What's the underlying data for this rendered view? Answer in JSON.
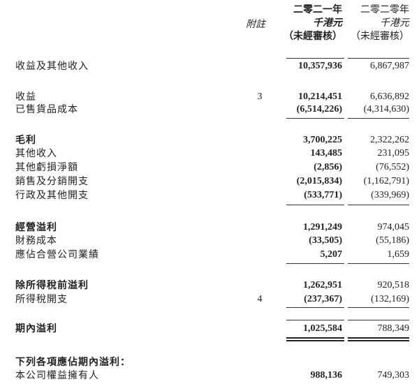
{
  "header": {
    "note_col": "附註",
    "cur_year": "二零二一年",
    "prev_year": "二零二零年",
    "cur_unit": "千港元",
    "prev_unit": "千港元",
    "cur_status": "（未經審核）",
    "prev_status": "（未經審核）"
  },
  "rows": [
    {
      "label": "收益及其他收入",
      "note": "",
      "cur": "10,357,936",
      "prev": "6,867,987",
      "bold": false
    },
    {
      "label": "收益",
      "note": "3",
      "cur": "10,214,451",
      "prev": "6,636,892",
      "bold": false
    },
    {
      "label": "已售貨品成本",
      "note": "",
      "cur": "(6,514,226)",
      "prev": "(4,314,630)",
      "bold": false
    },
    {
      "label": "毛利",
      "note": "",
      "cur": "3,700,225",
      "prev": "2,322,262",
      "bold": true
    },
    {
      "label": "其他收入",
      "note": "",
      "cur": "143,485",
      "prev": "231,095",
      "bold": false
    },
    {
      "label": "其他虧損淨額",
      "note": "",
      "cur": "(2,856)",
      "prev": "(76,552)",
      "bold": false
    },
    {
      "label": "銷售及分銷開支",
      "note": "",
      "cur": "(2,015,834)",
      "prev": "(1,162,791)",
      "bold": false
    },
    {
      "label": "行政及其他開支",
      "note": "",
      "cur": "(533,771)",
      "prev": "(339,969)",
      "bold": false
    },
    {
      "label": "經營溢利",
      "note": "",
      "cur": "1,291,249",
      "prev": "974,045",
      "bold": true
    },
    {
      "label": "財務成本",
      "note": "",
      "cur": "(33,505)",
      "prev": "(55,186)",
      "bold": false
    },
    {
      "label": "應佔合營公司業績",
      "note": "",
      "cur": "5,207",
      "prev": "1,659",
      "bold": false
    },
    {
      "label": "除所得稅前溢利",
      "note": "",
      "cur": "1,262,951",
      "prev": "920,518",
      "bold": true
    },
    {
      "label": "所得稅開支",
      "note": "4",
      "cur": "(237,367)",
      "prev": "(132,169)",
      "bold": false
    },
    {
      "label": "期內溢利",
      "note": "",
      "cur": "1,025,584",
      "prev": "788,349",
      "bold": true
    },
    {
      "label": "下列各項應佔期內溢利：",
      "note": "",
      "cur": "",
      "prev": "",
      "bold": true
    },
    {
      "label": "本公司權益擁有人",
      "note": "",
      "cur": "988,136",
      "prev": "749,303",
      "bold": false
    }
  ]
}
